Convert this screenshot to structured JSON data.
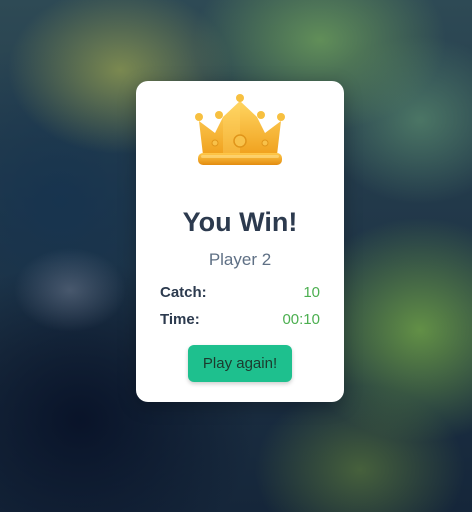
{
  "result": {
    "title": "You Win!",
    "player": "Player 2",
    "icon": "crown-icon"
  },
  "stats": [
    {
      "label": "Catch:",
      "value": "10"
    },
    {
      "label": "Time:",
      "value": "00:10"
    }
  ],
  "actions": {
    "play_again_label": "Play again!"
  },
  "colors": {
    "title": "#2c3a4e",
    "stat_value": "#4caf50",
    "button": "#1ec08e",
    "crown": "#f5b530"
  }
}
